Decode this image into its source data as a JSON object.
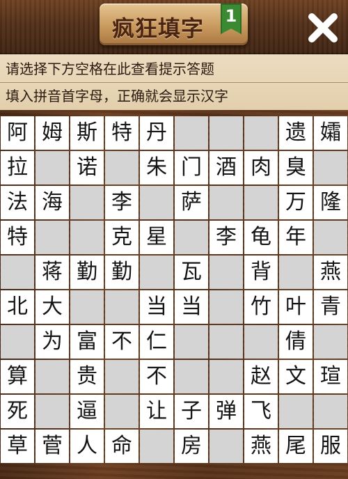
{
  "header": {
    "title": "疯狂填字",
    "level": "1",
    "close_icon": "close-icon"
  },
  "hint": {
    "line1": "请选择下方空格在此查看提示答题",
    "line2": "填入拼音首字母，正确就会显示汉字"
  },
  "board": {
    "columns": 10,
    "rows": 10,
    "grid": [
      [
        "阿",
        "姆",
        "斯",
        "特",
        "丹",
        null,
        null,
        null,
        "遗",
        "孀"
      ],
      [
        "拉",
        "",
        "诺",
        "",
        "朱",
        "门",
        "酒",
        "肉",
        "臭",
        ""
      ],
      [
        "法",
        "海",
        "",
        "李",
        "",
        "萨",
        "",
        "",
        "万",
        "隆"
      ],
      [
        "特",
        "",
        "",
        "克",
        "星",
        "",
        "李",
        "龟",
        "年",
        ""
      ],
      [
        "",
        "蒋",
        "勤",
        "勤",
        "",
        "瓦",
        "",
        "背",
        "",
        "燕"
      ],
      [
        "北",
        "大",
        "",
        "",
        "当",
        "当",
        "",
        "竹",
        "叶",
        "青"
      ],
      [
        "",
        "为",
        "富",
        "不",
        "仁",
        "",
        "",
        "",
        "倩",
        ""
      ],
      [
        "算",
        "",
        "贵",
        "",
        "不",
        "",
        "",
        "赵",
        "文",
        "瑄"
      ],
      [
        "死",
        "",
        "逼",
        "",
        "让",
        "子",
        "弹",
        "飞",
        "",
        ""
      ],
      [
        "草",
        "菅",
        "人",
        "命",
        "",
        "房",
        "",
        "燕",
        "尾",
        "服"
      ]
    ],
    "white_mask": [
      [
        1,
        1,
        1,
        1,
        1,
        0,
        0,
        0,
        1,
        1
      ],
      [
        1,
        0,
        1,
        0,
        1,
        1,
        1,
        1,
        1,
        0
      ],
      [
        1,
        1,
        0,
        1,
        0,
        1,
        0,
        0,
        1,
        1
      ],
      [
        1,
        0,
        0,
        1,
        1,
        0,
        1,
        1,
        1,
        0
      ],
      [
        0,
        1,
        1,
        1,
        0,
        1,
        0,
        1,
        0,
        1
      ],
      [
        1,
        1,
        0,
        0,
        1,
        1,
        0,
        1,
        1,
        1
      ],
      [
        0,
        1,
        1,
        1,
        1,
        0,
        0,
        0,
        1,
        0
      ],
      [
        1,
        0,
        1,
        0,
        1,
        0,
        0,
        1,
        1,
        1
      ],
      [
        1,
        0,
        1,
        0,
        1,
        1,
        1,
        1,
        0,
        0
      ],
      [
        1,
        1,
        1,
        1,
        0,
        1,
        0,
        1,
        1,
        1
      ]
    ]
  }
}
